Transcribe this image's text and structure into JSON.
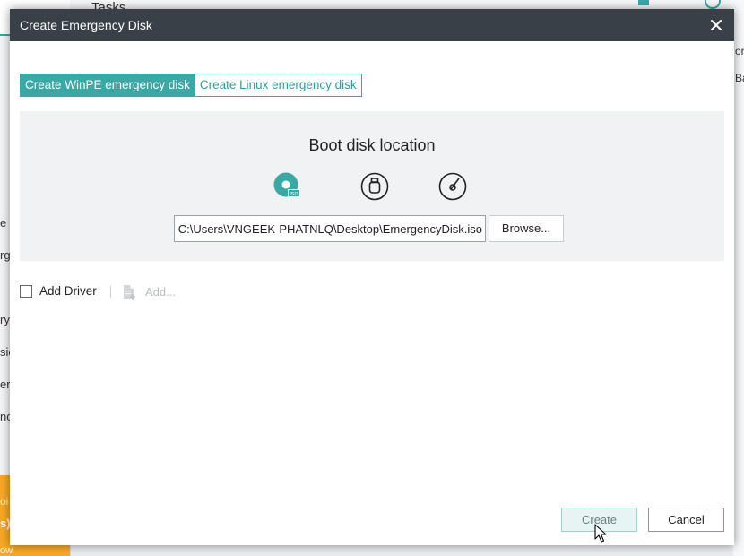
{
  "background": {
    "tasks_label": "Tasks",
    "left_fragments": [
      "e",
      "rg",
      "ry",
      "sio",
      "er",
      "no"
    ],
    "promo_fragments": [
      "oi",
      "s)",
      "ow"
    ],
    "right_fragments": [
      "or",
      "Ba"
    ]
  },
  "dialog": {
    "title": "Create Emergency Disk",
    "tabs": [
      {
        "label": "Create WinPE emergency disk",
        "active": true
      },
      {
        "label": "Create Linux emergency disk",
        "active": false
      }
    ],
    "boot_location": {
      "heading": "Boot disk location",
      "media_options": [
        {
          "icon": "iso-file-icon",
          "selected": true
        },
        {
          "icon": "usb-drive-icon",
          "selected": false
        },
        {
          "icon": "cd-dvd-icon",
          "selected": false
        }
      ],
      "path_value": "C:\\Users\\VNGEEK-PHATNLQ\\Desktop\\EmergencyDisk.iso",
      "browse_label": "Browse..."
    },
    "driver": {
      "checkbox_label": "Add Driver",
      "checked": false,
      "add_label": "Add..."
    },
    "buttons": {
      "create_label": "Create",
      "cancel_label": "Cancel"
    }
  },
  "colors": {
    "accent": "#3aa9a6",
    "titlebar": "#3a4047"
  }
}
